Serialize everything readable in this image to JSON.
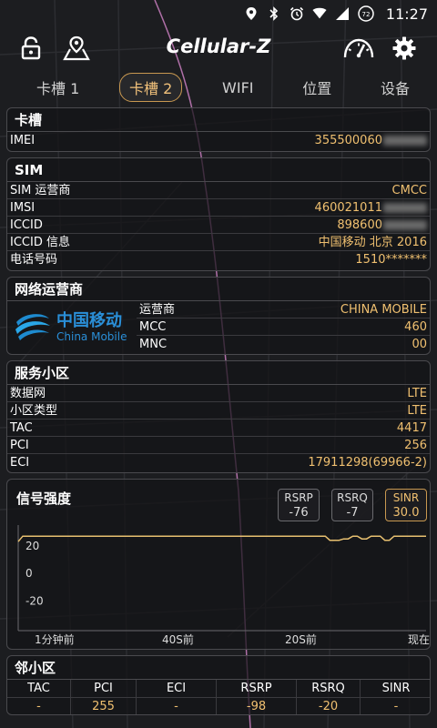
{
  "status_bar": {
    "time": "11:27",
    "battery": "72"
  },
  "app_bar": {
    "title": "Cellular-Z"
  },
  "tabs": [
    {
      "label": "卡槽 1",
      "active": false
    },
    {
      "label": "卡槽 2",
      "active": true
    },
    {
      "label": "WIFI",
      "active": false
    },
    {
      "label": "位置",
      "active": false
    },
    {
      "label": "设备",
      "active": false
    }
  ],
  "slot_card": {
    "title": "卡槽",
    "imei_label": "IMEI",
    "imei_value": "355500060"
  },
  "sim_card": {
    "title": "SIM",
    "rows": [
      {
        "label": "SIM 运营商",
        "value": "CMCC"
      },
      {
        "label": "IMSI",
        "value": "460021011"
      },
      {
        "label": "ICCID",
        "value": "898600"
      },
      {
        "label": "ICCID 信息",
        "value": "中国移动 北京 2016"
      },
      {
        "label": "电话号码",
        "value": "1510*******"
      }
    ]
  },
  "operator_card": {
    "title": "网络运营商",
    "logo_cn": "中国移动",
    "logo_en": "China Mobile",
    "rows": [
      {
        "label": "运营商",
        "value": "CHINA MOBILE"
      },
      {
        "label": "MCC",
        "value": "460"
      },
      {
        "label": "MNC",
        "value": "00"
      }
    ]
  },
  "cell_card": {
    "title": "服务小区",
    "rows": [
      {
        "label": "数据网",
        "value": "LTE"
      },
      {
        "label": "小区类型",
        "value": "LTE"
      },
      {
        "label": "TAC",
        "value": "4417"
      },
      {
        "label": "PCI",
        "value": "256"
      },
      {
        "label": "ECI",
        "value": "17911298(69966-2)"
      }
    ]
  },
  "signal_card": {
    "title": "信号强度",
    "badges": [
      {
        "label": "RSRP",
        "value": "-76",
        "active": false
      },
      {
        "label": "RSRQ",
        "value": "-7",
        "active": false
      },
      {
        "label": "SINR",
        "value": "30.0",
        "active": true
      }
    ],
    "chart_data": {
      "type": "line",
      "series": [
        {
          "values": [
            23,
            27,
            27,
            27,
            27,
            27,
            27,
            27,
            27,
            27,
            27,
            27,
            27,
            27,
            27,
            27,
            27,
            27,
            27,
            27,
            27,
            27,
            27,
            27,
            27,
            27,
            27,
            27,
            27,
            27,
            27,
            27,
            27,
            27,
            27,
            27,
            27,
            27,
            27,
            27,
            27,
            27,
            27,
            27,
            27,
            27,
            27,
            27,
            27,
            27,
            27,
            27,
            27,
            27,
            27,
            27,
            27,
            27,
            27,
            27,
            27,
            27,
            27,
            27,
            27,
            27,
            27,
            27,
            24,
            24,
            24,
            25,
            25,
            27,
            27,
            25,
            25,
            27,
            27,
            27,
            24,
            24,
            27,
            27,
            27,
            27,
            27,
            27,
            27,
            27
          ]
        }
      ],
      "yticks": [
        "20",
        "0",
        "-20"
      ],
      "ytick_values": [
        20,
        0,
        -20
      ],
      "ylim": [
        -40,
        35
      ],
      "xticks": [
        "1分钟前",
        "40S前",
        "20S前",
        "现在"
      ],
      "line_color": "#e8c070"
    }
  },
  "neighbor_card": {
    "title": "邻小区",
    "headers": [
      "TAC",
      "PCI",
      "ECI",
      "RSRP",
      "RSRQ",
      "SINR"
    ],
    "rows": [
      [
        "-",
        "255",
        "-",
        "-98",
        "-20",
        "-"
      ]
    ]
  },
  "colors": {
    "accent": "#f0c070",
    "background": "#1c1d20",
    "border": "#4a4a4e"
  }
}
